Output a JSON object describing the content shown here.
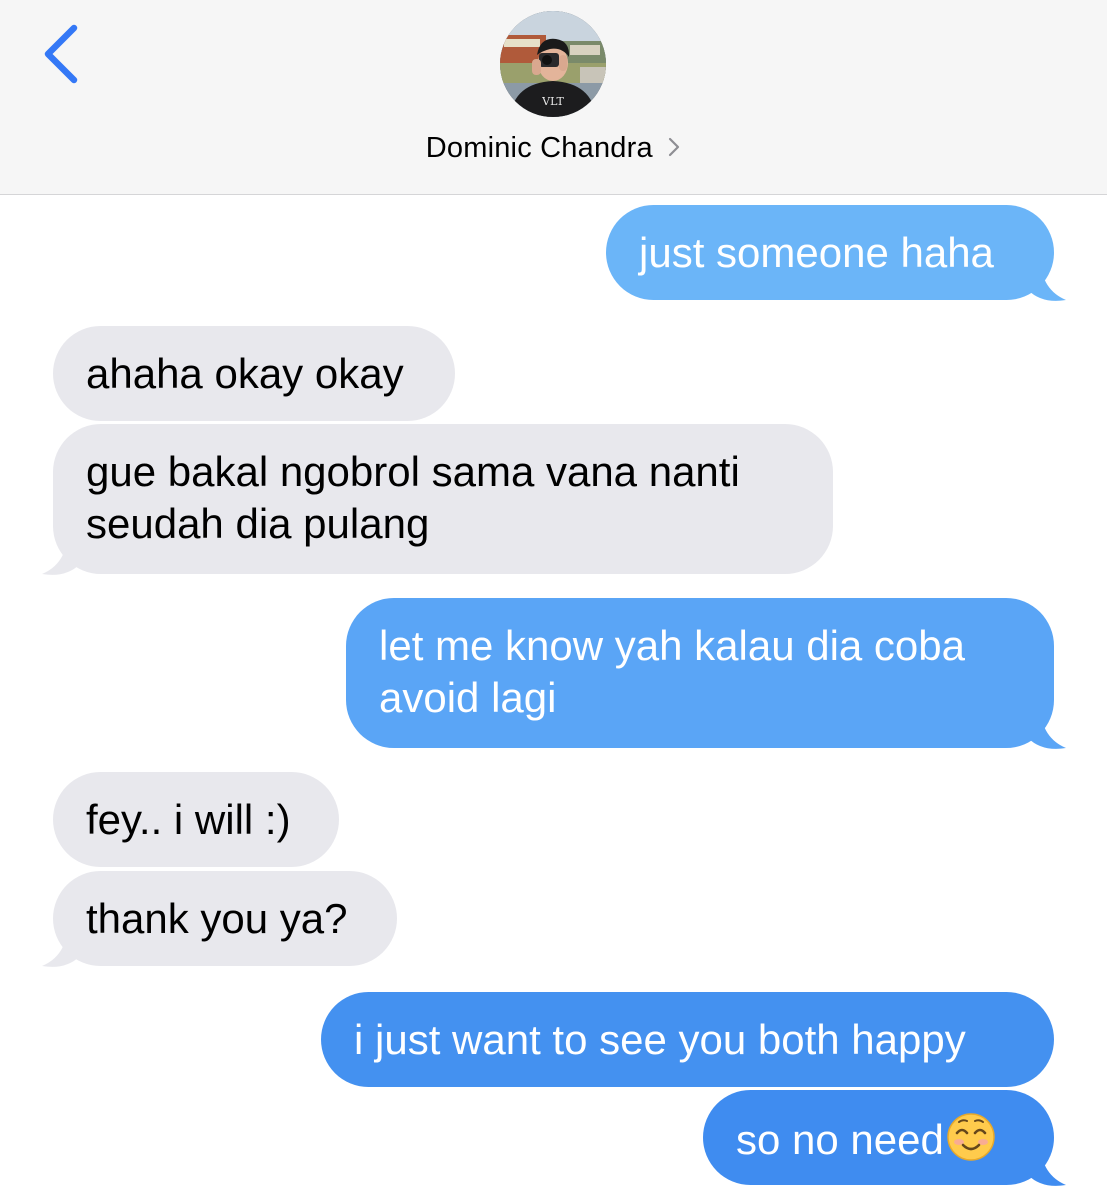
{
  "header": {
    "back_icon": "chevron-left-icon",
    "contact_name": "Dominic Chandra",
    "detail_icon": "chevron-right-icon",
    "avatar_shirt_text": "VLT",
    "accent_color": "#3478f6"
  },
  "messages": [
    {
      "direction": "sent",
      "text": "just someone haha",
      "color": "#6bb5f8"
    },
    {
      "direction": "received",
      "text": "ahaha okay okay"
    },
    {
      "direction": "received",
      "lines": [
        "gue bakal ngobrol sama vana nanti",
        "seudah dia pulang"
      ]
    },
    {
      "direction": "sent",
      "lines": [
        "let me know yah kalau dia coba",
        "avoid lagi"
      ],
      "color": "#5aa5f6"
    },
    {
      "direction": "received",
      "text": "fey.. i will :)"
    },
    {
      "direction": "received",
      "text": "thank you ya?"
    },
    {
      "direction": "sent",
      "text": "i just want to see you both happy",
      "color": "#4491f0"
    },
    {
      "direction": "sent",
      "text": "so no need",
      "emoji": "☺️",
      "emoji_icon": "smiling-face-icon",
      "color": "#3f8cf0"
    }
  ]
}
